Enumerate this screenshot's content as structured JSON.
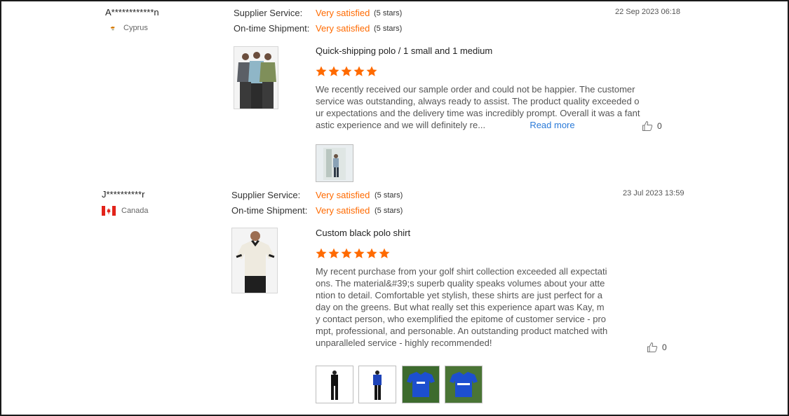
{
  "labels": {
    "supplier_service": "Supplier Service:",
    "ontime_shipment": "On-time Shipment:",
    "read_more": "Read more"
  },
  "reviews": [
    {
      "reviewer": "A************n",
      "country": "Cyprus",
      "supplier_rating": "Very satisfied",
      "supplier_stars": "(5 stars)",
      "shipment_rating": "Very satisfied",
      "shipment_stars": "(5 stars)",
      "date": "22 Sep 2023 06:18",
      "product_title": "Quick-shipping polo / 1 small and 1 medium",
      "rating": 5,
      "text": "We recently received our sample order and could not be happier. The customer service was outstanding, always ready to assist. The product quality exceeded our expectations and the delivery time was incredibly prompt. Overall it was a fantastic experience and we will definitely re...",
      "helpful_count": "0",
      "product_image": "three-men-patterned-polo-shirts",
      "photos": [
        "customer-photo-person-standing"
      ]
    },
    {
      "reviewer": "J**********r",
      "country": "Canada",
      "supplier_rating": "Very satisfied",
      "supplier_stars": "(5 stars)",
      "shipment_rating": "Very satisfied",
      "shipment_stars": "(5 stars)",
      "date": "23 Jul 2023 13:59",
      "product_title": "Custom black polo shirt",
      "rating": 5,
      "text": "My recent purchase from your golf shirt collection exceeded all expectations. The material&#39;s superb quality speaks volumes about your attention to detail. Comfortable yet stylish, these shirts are just perfect for a day on the greens. But what really set this experience apart was Kay, my contact person, who exemplified the epitome of customer service - prompt, professional, and personable. An outstanding product matched with unparalleled service - highly recommended!",
      "helpful_count": "0",
      "product_image": "man-white-polo-black-collar",
      "photos": [
        "photo-black-outfit",
        "photo-blue-polo-worn",
        "photo-blue-polo-on-grass",
        "photo-blue-polo-on-grass-2"
      ]
    }
  ],
  "colors": {
    "accent": "#ff6a00",
    "link": "#2a7ad8",
    "text": "#555555"
  }
}
